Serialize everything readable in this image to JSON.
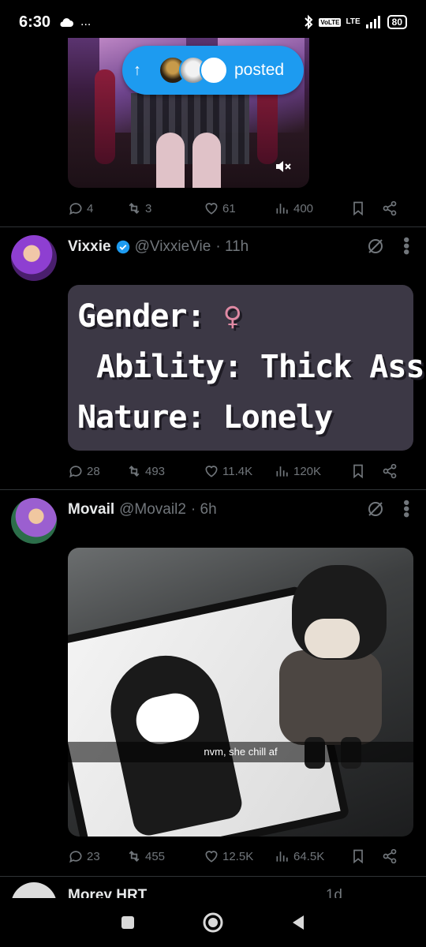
{
  "status_bar": {
    "time": "6:30",
    "extra_dots": "...",
    "network": "LTE",
    "volte": "VoLTE",
    "battery": "80"
  },
  "top_tweet": {
    "posted_pill_label": "posted",
    "replies": "4",
    "reposts": "3",
    "likes": "61",
    "views": "400"
  },
  "tweets": [
    {
      "display_name": "Vixxie",
      "handle": "@VixxieVie",
      "time": "· 11h",
      "verified": true,
      "card_lines": [
        "Gender:",
        "Ability: Thick Ass",
        "Nature: Lonely"
      ],
      "card_symbol": "♀",
      "replies": "28",
      "reposts": "493",
      "likes": "11.4K",
      "views": "120K"
    },
    {
      "display_name": "Movail",
      "handle": "@Movail2",
      "time": "· 6h",
      "verified": false,
      "photo_caption": "nvm, she chill af",
      "replies": "23",
      "reposts": "455",
      "likes": "12.5K",
      "views": "64.5K"
    }
  ],
  "next_tweet": {
    "display_name": "Morey HRT",
    "time": "1d"
  },
  "colors": {
    "accent": "#1d9bf0",
    "muted": "#71767b",
    "text": "#e7e9ea",
    "background": "#000000"
  },
  "icons": [
    "cloud-icon",
    "bluetooth-icon",
    "signal-icon",
    "battery-icon",
    "reply-icon",
    "repost-icon",
    "like-icon",
    "views-icon",
    "bookmark-icon",
    "share-icon",
    "verified-icon",
    "grok-icon",
    "more-icon",
    "mute-icon",
    "nav-square-icon",
    "nav-home-icon",
    "nav-back-icon"
  ]
}
